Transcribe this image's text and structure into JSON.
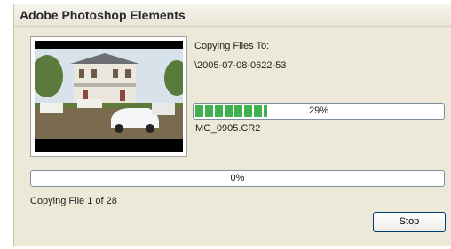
{
  "window": {
    "title": "Adobe Photoshop Elements"
  },
  "copy": {
    "heading": "Copying Files To:",
    "destination": "\\2005-07-08-0622-53",
    "file_progress_text": "29%",
    "file_progress_value": 0.29,
    "current_file": "IMG_0905.CR2",
    "overall_progress_text": "0%",
    "overall_progress_value": 0,
    "status": "Copying File 1 of 28"
  },
  "buttons": {
    "stop": "Stop"
  },
  "colors": {
    "progress_fill": "#3fb24f",
    "dialog_bg": "#ece9d8"
  }
}
